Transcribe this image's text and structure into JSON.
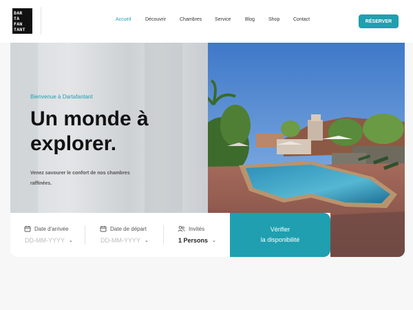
{
  "logo": {
    "lines": [
      "DAR",
      "TA",
      "FAN",
      "TANT"
    ]
  },
  "nav": {
    "items": [
      {
        "label": "Accueil",
        "active": true
      },
      {
        "label": "Découvrir",
        "active": false
      },
      {
        "label": "Chambres",
        "active": false
      },
      {
        "label": "Service",
        "active": false
      },
      {
        "label": "Blog",
        "active": false
      },
      {
        "label": "Shop",
        "active": false
      },
      {
        "label": "Contact",
        "active": false
      }
    ],
    "cta_label": "RÉSERVER"
  },
  "hero": {
    "tagline": "Bienvenue à Dartafantant",
    "title_line1": "Un monde à",
    "title_line2": "explorer.",
    "subtitle_line1": "Venez savourer le confort de nos chambres",
    "subtitle_line2": "raffinées."
  },
  "booking": {
    "arrival": {
      "label": "Date d'arrivée",
      "value": "DD-MM-YYYY",
      "icon": "calendar-icon"
    },
    "departure": {
      "label": "Date de départ",
      "value": "DD-MM-YYYY",
      "icon": "calendar-icon"
    },
    "guests": {
      "label": "Invités",
      "value": "1 Persons",
      "icon": "users-icon"
    },
    "submit_line1": "Vérifier",
    "submit_line2": "la disponibilité"
  },
  "colors": {
    "accent": "#1f9fb0"
  }
}
